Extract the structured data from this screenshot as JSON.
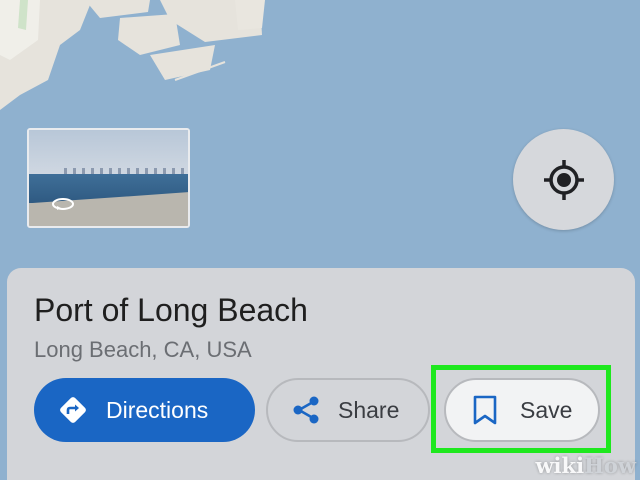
{
  "place": {
    "title": "Port of Long Beach",
    "address": "Long Beach, CA, USA"
  },
  "actions": {
    "directions_label": "Directions",
    "share_label": "Share",
    "save_label": "Save"
  },
  "icons": {
    "directions": "directions-icon",
    "share": "share-icon",
    "save": "bookmark-icon",
    "locate": "my-location-icon",
    "street_view_rotate": "rotate-360-icon"
  },
  "colors": {
    "map_water": "#8fb1cf",
    "primary": "#1a66c4",
    "highlight": "#1ee81e"
  },
  "watermark": {
    "wiki": "wiki",
    "how": "How"
  }
}
